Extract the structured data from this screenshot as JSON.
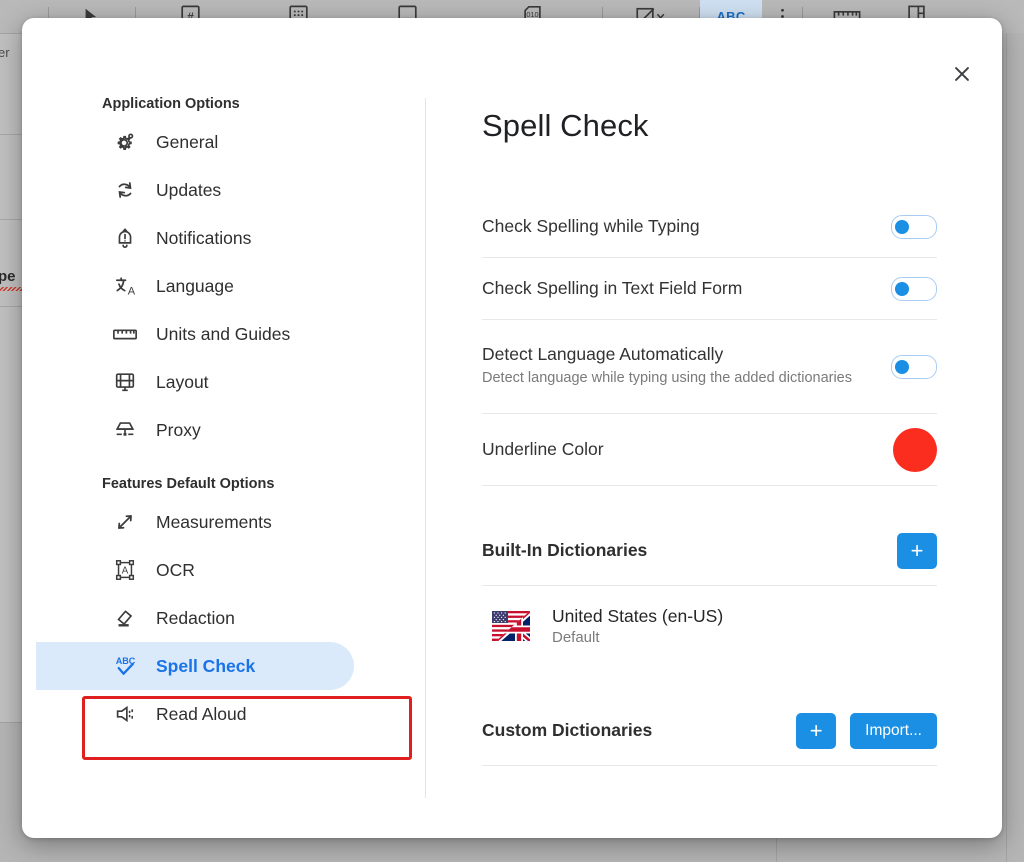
{
  "background": {
    "toolbar": {
      "tools": [
        {
          "name": "select-text-tool",
          "icon": "cursor-text-icon"
        },
        {
          "name": "page-number-tool",
          "icon": "hash-page-icon"
        },
        {
          "name": "bates-numbering-tool",
          "icon": "dotted-grid-icon"
        },
        {
          "name": "header-footer-tool",
          "icon": "document-bar-icon"
        },
        {
          "name": "binary-field-tool",
          "icon": "zero-one-zero-icon"
        },
        {
          "name": "annotate-tool",
          "icon": "pen-square-icon"
        },
        {
          "name": "spell-check-tool",
          "label": "ABC",
          "icon": "abc-icon"
        },
        {
          "name": "more-options",
          "icon": "vertical-dots-icon"
        },
        {
          "name": "measure-tool",
          "icon": "ruler-icon"
        },
        {
          "name": "layout-tool",
          "icon": "layout-panel-icon"
        }
      ]
    },
    "page_fragments": {
      "top_word": "er",
      "mid_word": "pe"
    }
  },
  "modal": {
    "close_label": "×",
    "sidebar": {
      "groups": [
        {
          "title": "Application Options",
          "items": [
            {
              "label": "General",
              "icon": "gear-icon",
              "active": false
            },
            {
              "label": "Updates",
              "icon": "refresh-icon",
              "active": false
            },
            {
              "label": "Notifications",
              "icon": "bell-alert-icon",
              "active": false
            },
            {
              "label": "Language",
              "icon": "translate-icon",
              "active": false
            },
            {
              "label": "Units and Guides",
              "icon": "ruler-icon",
              "active": false
            },
            {
              "label": "Layout",
              "icon": "layout-icon",
              "active": false
            },
            {
              "label": "Proxy",
              "icon": "proxy-server-icon",
              "active": false
            }
          ]
        },
        {
          "title": "Features Default Options",
          "items": [
            {
              "label": "Measurements",
              "icon": "double-arrow-icon",
              "active": false
            },
            {
              "label": "OCR",
              "icon": "ocr-frame-icon",
              "active": false
            },
            {
              "label": "Redaction",
              "icon": "eraser-icon",
              "active": false
            },
            {
              "label": "Spell Check",
              "icon": "abc-check-icon",
              "active": true
            },
            {
              "label": "Read Aloud",
              "icon": "speaker-icon",
              "active": false
            }
          ]
        }
      ]
    },
    "content": {
      "title": "Spell Check",
      "settings": [
        {
          "label": "Check Spelling while Typing",
          "sub": "",
          "control": "toggle",
          "value": "on"
        },
        {
          "label": "Check Spelling in Text Field Form",
          "sub": "",
          "control": "toggle",
          "value": "on"
        },
        {
          "label": "Detect Language Automatically",
          "sub": "Detect language while typing using the added dictionaries",
          "control": "toggle",
          "value": "on"
        },
        {
          "label": "Underline Color",
          "sub": "",
          "control": "color",
          "value": "#fa2d1e"
        }
      ],
      "builtin_dictionaries": {
        "title": "Built-In Dictionaries",
        "add_label": "+",
        "entries": [
          {
            "name": "United States (en-US)",
            "sub": "Default",
            "flag": "us-uk-flag-icon"
          }
        ]
      },
      "custom_dictionaries": {
        "title": "Custom Dictionaries",
        "add_label": "+",
        "import_label": "Import..."
      }
    }
  },
  "colors": {
    "accent_blue": "#1a8fe8",
    "active_pill": "#dbeafa",
    "underline_red": "#fa2d1e",
    "annotation_red": "#e02020"
  }
}
